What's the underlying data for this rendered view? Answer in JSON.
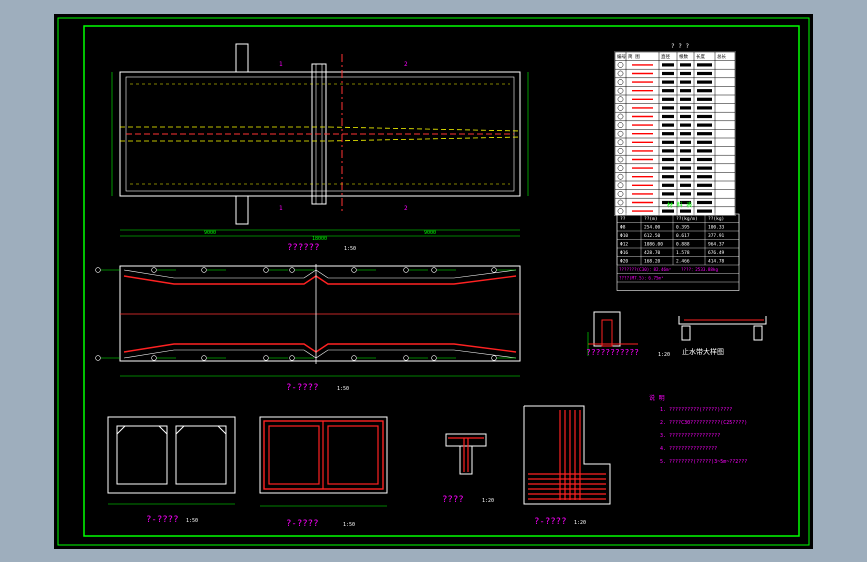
{
  "drawing": {
    "plan_title": "??????",
    "plan_scale": "1:50",
    "section_a_title": "?-????",
    "section_a_scale": "1:50",
    "cross_b_title": "?-????",
    "cross_b_scale": "1:50",
    "rebar_c_title": "?-????",
    "rebar_c_scale": "1:50",
    "detail_d_title": "????",
    "detail_d_scale": "1:20",
    "corner_e_title": "?-????",
    "corner_e_scale": "1:20",
    "joint_title": "???????????",
    "joint_scale": "1:20",
    "waterstop_title": "止水带大样图",
    "notes_heading": "说 明",
    "notes": [
      "1. ??????????(?????)????",
      "2. ????C30??????????(C25????)",
      "3. ?????????????????",
      "4. ????????????????",
      "5. ????????(?????)3~5m~??2???"
    ],
    "table_title": "? ? ?",
    "table_headers": [
      "编号",
      "简 图",
      "直径",
      "根数",
      "长度",
      "总长"
    ],
    "summary_title": "材 料 表",
    "summary_headers": [
      "??",
      "??(m)",
      "??(kg/m)",
      "??(kg)"
    ],
    "summary_rows": [
      [
        "Φ8",
        "254.00",
        "0.395",
        "100.33"
      ],
      [
        "Φ10",
        "612.50",
        "0.617",
        "377.91"
      ],
      [
        "Φ12",
        "1086.00",
        "0.888",
        "964.37"
      ],
      [
        "Φ16",
        "428.70",
        "1.578",
        "676.49"
      ],
      [
        "Φ20",
        "168.20",
        "2.466",
        "414.78"
      ]
    ],
    "summary_footer_left": "???????(C30)：82.46m³",
    "summary_footer_right": "????：2533.88kg",
    "summary_footer_left2": "????(M7.5)：6.75m³",
    "dim_total": "18000",
    "dim_left": "9000",
    "dim_right": "9000",
    "label_1": "1",
    "label_2": "2"
  }
}
